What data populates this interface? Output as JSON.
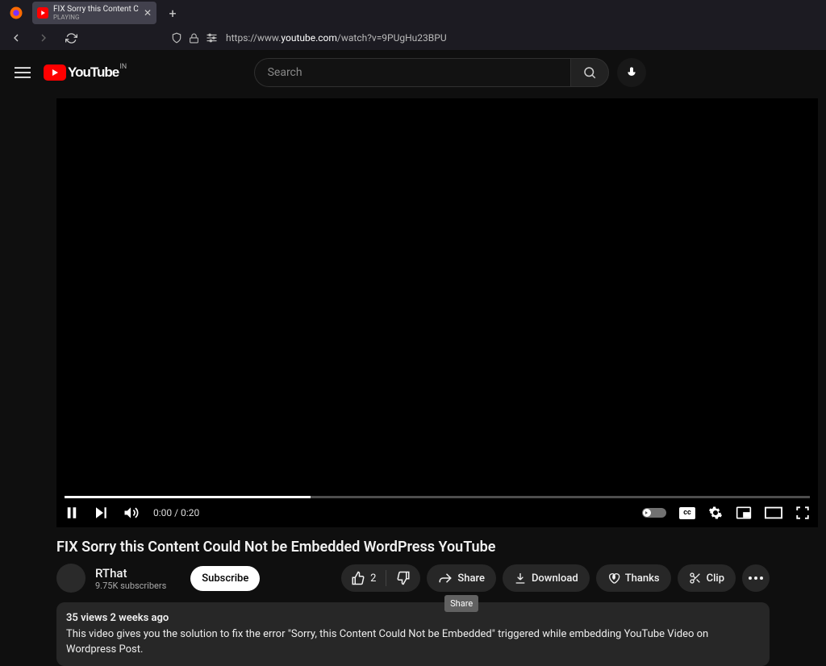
{
  "browser": {
    "tab": {
      "title": "FIX Sorry this Content Could N",
      "subtitle": "PLAYING"
    },
    "url_prefix": "https://www.",
    "url_domain": "youtube.com",
    "url_path": "/watch?v=9PUgHu23BPU"
  },
  "masthead": {
    "logo_text": "YouTube",
    "country": "IN",
    "search_placeholder": "Search"
  },
  "player": {
    "time": "0:00 / 0:20",
    "cc_label": "cc"
  },
  "video": {
    "title": "FIX Sorry this Content Could Not be Embedded WordPress YouTube"
  },
  "channel": {
    "name": "RThat",
    "subs": "9.75K subscribers",
    "subscribe_label": "Subscribe"
  },
  "actions": {
    "like_count": "2",
    "share": "Share",
    "download": "Download",
    "thanks": "Thanks",
    "clip": "Clip"
  },
  "tooltip": {
    "share": "Share"
  },
  "description": {
    "meta": "35 views  2 weeks ago",
    "text": "This video gives you the solution to fix the error \"Sorry, this Content Could Not be Embedded\" triggered while embedding YouTube Video on Wordpress Post."
  }
}
